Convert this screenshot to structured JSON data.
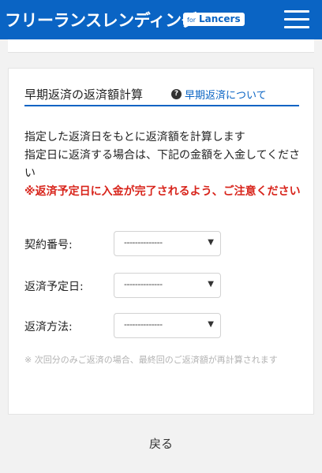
{
  "header": {
    "brand": "フリーランスレンディング",
    "badge_for": "for",
    "badge_name": "Lancers",
    "menu_icon": "hamburger-menu-icon",
    "bg_color": "#0a64c4"
  },
  "section": {
    "title": "早期返済の返済額計算",
    "help_icon": "question-circle-icon",
    "help_link": "早期返済について",
    "description_1": "指定した返済日をもとに返済額を計算します",
    "description_2": "指定日に返済する場合は、下記の金額を入金してください",
    "warning": "※返済予定日に入金が完了されるよう、ご注意ください",
    "warning_color": "#d8241b"
  },
  "form": {
    "fields": [
      {
        "label": "契約番号:",
        "value": "--------------"
      },
      {
        "label": "返済予定日:",
        "value": "--------------"
      },
      {
        "label": "返済方法:",
        "value": "--------------"
      }
    ]
  },
  "note": "※ 次回分のみご返済の場合、最終回のご返済額が再計算されます",
  "back_label": "戻る"
}
